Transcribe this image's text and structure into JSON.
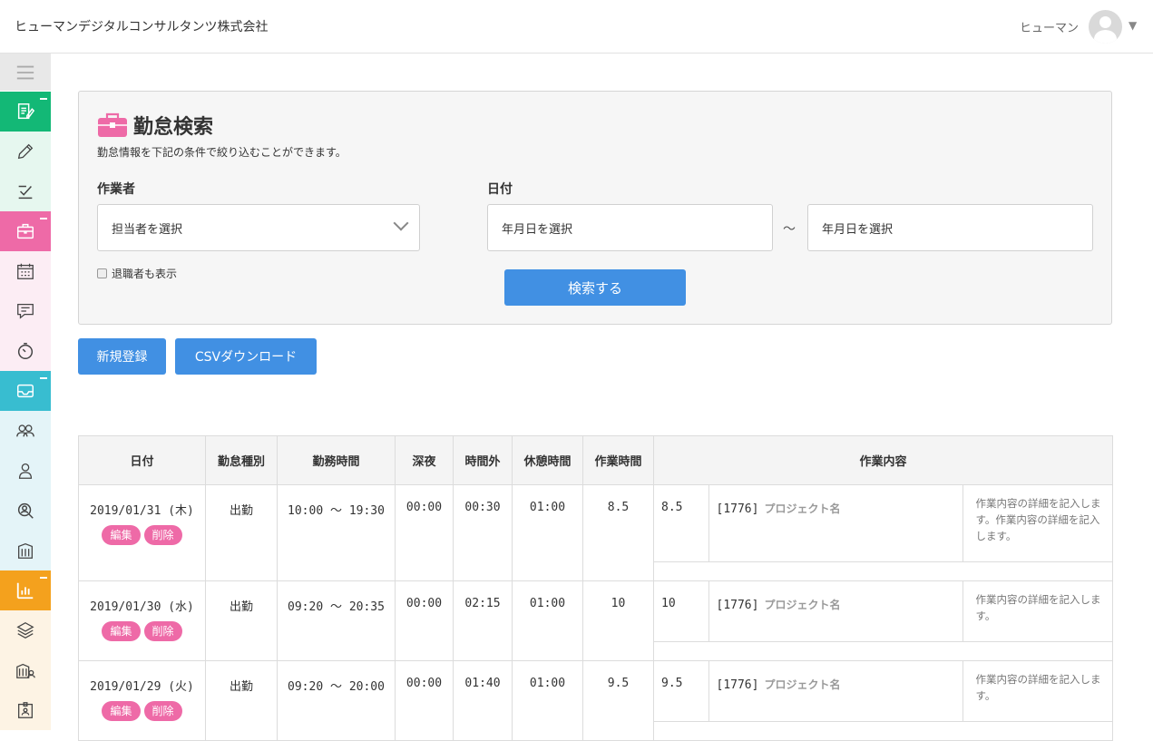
{
  "header": {
    "company": "ヒューマンデジタルコンサルタンツ株式会社",
    "user_name": "ヒューマン",
    "avatar_icon": "user-avatar-icon",
    "caret_icon": "caret-down-icon"
  },
  "sidebar": {
    "items": [
      {
        "name": "menu-icon"
      },
      {
        "name": "report-edit-icon",
        "color": "#13b876"
      },
      {
        "name": "pencil-icon"
      },
      {
        "name": "check-list-icon"
      },
      {
        "name": "briefcase-icon",
        "color": "#ee6aa7"
      },
      {
        "name": "calendar-icon"
      },
      {
        "name": "chat-icon"
      },
      {
        "name": "timer-icon"
      },
      {
        "name": "inbox-icon",
        "color": "#38bdd0"
      },
      {
        "name": "users-group-icon"
      },
      {
        "name": "user-icon"
      },
      {
        "name": "user-search-icon"
      },
      {
        "name": "building-icon"
      },
      {
        "name": "bar-chart-icon",
        "color": "#f4a11d"
      },
      {
        "name": "layers-icon"
      },
      {
        "name": "building-user-icon"
      },
      {
        "name": "id-card-icon"
      }
    ]
  },
  "search": {
    "title": "勤怠検索",
    "description": "勤怠情報を下記の条件で絞り込むことができます。",
    "worker_label": "作業者",
    "worker_placeholder": "担当者を選択",
    "date_label": "日付",
    "date_from_placeholder": "年月日を選択",
    "date_to_placeholder": "年月日を選択",
    "range_separator": "～",
    "show_retired_label": "退職者も表示",
    "search_button": "検索する"
  },
  "actions": {
    "new_button": "新規登録",
    "csv_button": "CSVダウンロード"
  },
  "table": {
    "headers": [
      "日付",
      "勤怠種別",
      "勤務時間",
      "深夜",
      "時間外",
      "休憩時間",
      "作業時間",
      "作業内容"
    ],
    "edit_label": "編集",
    "delete_label": "削除",
    "rows": [
      {
        "date": "2019/01/31 (木)",
        "type": "出勤",
        "hours": "10:00 ～ 19:30",
        "night": "00:00",
        "overtime": "00:30",
        "break": "01:00",
        "work": "8.5",
        "task_hours": "8.5",
        "project_id": "[1776]",
        "project_name": "プロジェクト名",
        "detail": "作業内容の詳細を記入します。作業内容の詳細を記入します。"
      },
      {
        "date": "2019/01/30 (水)",
        "type": "出勤",
        "hours": "09:20 ～ 20:35",
        "night": "00:00",
        "overtime": "02:15",
        "break": "01:00",
        "work": "10",
        "task_hours": "10",
        "project_id": "[1776]",
        "project_name": "プロジェクト名",
        "detail": "作業内容の詳細を記入します。"
      },
      {
        "date": "2019/01/29 (火)",
        "type": "出勤",
        "hours": "09:20 ～ 20:00",
        "night": "00:00",
        "overtime": "01:40",
        "break": "01:00",
        "work": "9.5",
        "task_hours": "9.5",
        "project_id": "[1776]",
        "project_name": "プロジェクト名",
        "detail": "作業内容の詳細を記入します。"
      }
    ]
  }
}
